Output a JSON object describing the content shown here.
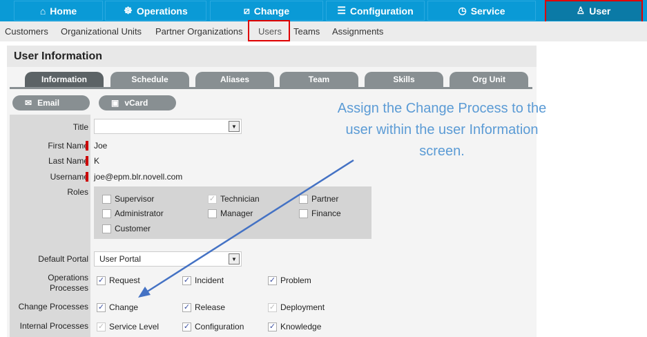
{
  "topnav": [
    {
      "label": "Home",
      "icon": "home-icon"
    },
    {
      "label": "Operations",
      "icon": "wheel-icon"
    },
    {
      "label": "Change",
      "icon": "change-icon"
    },
    {
      "label": "Configuration",
      "icon": "sliders-icon"
    },
    {
      "label": "Service",
      "icon": "clock-icon"
    },
    {
      "label": "User",
      "icon": "user-icon",
      "selected": true
    }
  ],
  "subnav": [
    "Customers",
    "Organizational Units",
    "Partner Organizations",
    "Users",
    "Teams",
    "Assignments"
  ],
  "panel_title": "User Information",
  "tabs": [
    "Information",
    "Schedule",
    "Aliases",
    "Team",
    "Skills",
    "Org Unit"
  ],
  "actions": {
    "email": "Email",
    "vcard": "vCard"
  },
  "form": {
    "title_label": "Title",
    "title_value": "",
    "first_name_label": "First Name",
    "first_name": "Joe",
    "last_name_label": "Last Name",
    "last_name": "K",
    "username_label": "Username",
    "username": "joe@epm.blr.novell.com",
    "roles_label": "Roles",
    "roles": [
      {
        "label": "Supervisor",
        "checked": false
      },
      {
        "label": "Technician",
        "checked": true,
        "disabled": true
      },
      {
        "label": "Partner",
        "checked": false
      },
      {
        "label": "Administrator",
        "checked": false
      },
      {
        "label": "Manager",
        "checked": false
      },
      {
        "label": "Finance",
        "checked": false
      },
      {
        "label": "Customer",
        "checked": false
      }
    ],
    "default_portal_label": "Default Portal",
    "default_portal": "User Portal",
    "ops_label_1": "Operations",
    "ops_label_2": "Processes",
    "ops": [
      {
        "label": "Request",
        "checked": true
      },
      {
        "label": "Incident",
        "checked": true
      },
      {
        "label": "Problem",
        "checked": true
      }
    ],
    "change_label": "Change Processes",
    "change": [
      {
        "label": "Change",
        "checked": true
      },
      {
        "label": "Release",
        "checked": true
      },
      {
        "label": "Deployment",
        "checked": true,
        "disabled": true
      }
    ],
    "internal_label": "Internal Processes",
    "internal": [
      {
        "label": "Service Level",
        "checked": true,
        "disabled": true
      },
      {
        "label": "Configuration",
        "checked": true
      },
      {
        "label": "Knowledge",
        "checked": true
      }
    ]
  },
  "annotation": {
    "line1": "Assign the Change Process to the",
    "line2": "user within the user Information",
    "line3": "screen.",
    "color": "#5b9bd5"
  }
}
